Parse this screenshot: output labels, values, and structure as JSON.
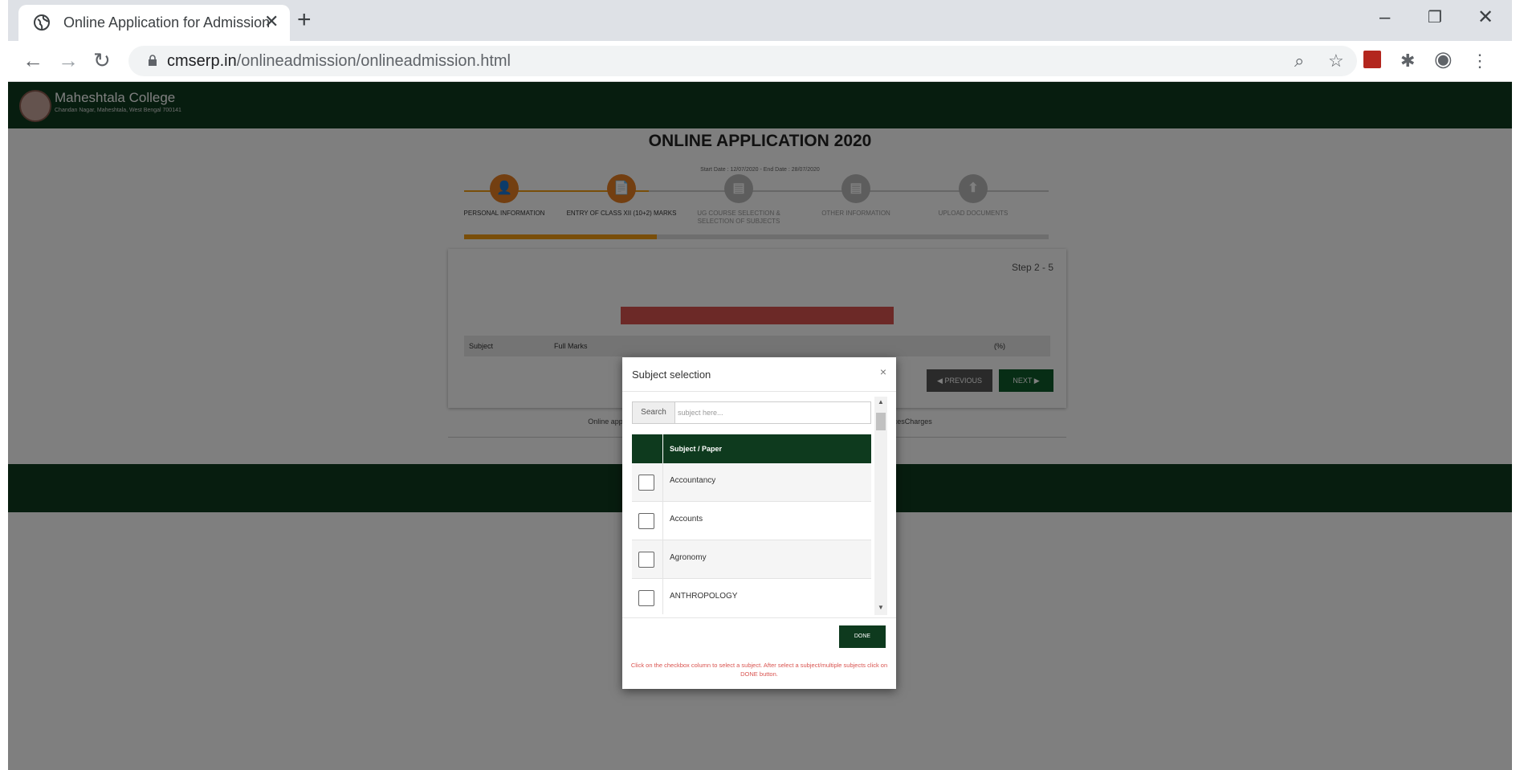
{
  "browser": {
    "tab_title": "Online Application for Admission",
    "tab_close": "✕",
    "new_tab": "+",
    "window_controls": {
      "minimize": "–",
      "restore": "❐",
      "close": "✕"
    },
    "url_host": "cmserp.in",
    "url_path": "/onlineadmission/onlineadmission.html",
    "nav": {
      "back": "←",
      "forward": "→",
      "reload": "↻"
    },
    "toolbar_icons": {
      "zoom": "⌕",
      "bookmark": "☆",
      "pdf": "⬛",
      "extensions": "✱",
      "profile": "◉",
      "menu": "⋮"
    }
  },
  "site": {
    "college_name": "Maheshtala College",
    "college_address": "Chandan Nagar, Maheshtala, West Bengal 700141",
    "app_title": "ONLINE APPLICATION 2020",
    "dates": "Start Date : 12/07/2020 - End Date : 28/07/2020",
    "steps": [
      {
        "label": "PERSONAL INFORMATION",
        "icon": "👤"
      },
      {
        "label": "ENTRY OF CLASS XII (10+2) MARKS",
        "icon": "📄"
      },
      {
        "label": "UG COURSE SELECTION & SELECTION OF SUBJECTS",
        "icon": "▤"
      },
      {
        "label": "OTHER INFORMATION",
        "icon": "▤"
      },
      {
        "label": "UPLOAD DOCUMENTS",
        "icon": "⬆"
      }
    ],
    "step_count": "Step 2 - 5",
    "table_headers": {
      "subject": "Subject",
      "full_marks": "Full Marks",
      "pct": "(%)"
    },
    "btn_previous": "◀ PREVIOUS",
    "btn_next": "NEXT ▶",
    "footnote_left": "Online appl",
    "footnote_right": "cesCharges"
  },
  "modal": {
    "title": "Subject selection",
    "close": "×",
    "search_label": "Search",
    "search_placeholder": "subject here...",
    "column_header": "Subject / Paper",
    "subjects": [
      "Accountancy",
      "Accounts",
      "Agronomy",
      "ANTHROPOLOGY"
    ],
    "done_label": "DONE",
    "note": "Click on the checkbox column to select a subject. After select a subject/multiple subjects click on DONE button."
  },
  "colors": {
    "header_green": "#0e3a1e",
    "accent_orange": "#e67e22",
    "note_red": "#d9534f"
  }
}
